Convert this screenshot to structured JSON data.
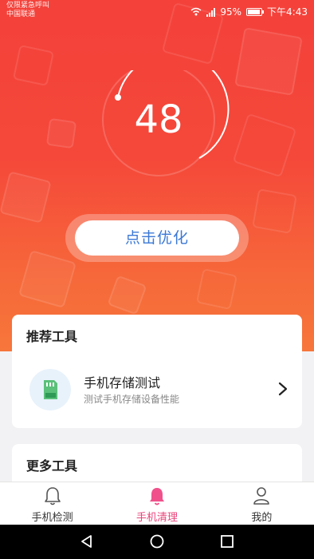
{
  "status_bar": {
    "carrier_line1": "仅限紧急呼叫",
    "carrier_line2": "中国联通",
    "battery": "95%",
    "time": "下午4:43",
    "icons": [
      "wifi-icon",
      "signal-icon",
      "battery-icon"
    ]
  },
  "score": {
    "value": "48"
  },
  "optimize_button": {
    "label": "点击优化"
  },
  "recommended": {
    "title": "推荐工具",
    "items": [
      {
        "name": "手机存储测试",
        "description": "测试手机存储设备性能",
        "icon": "sd-card-icon"
      }
    ]
  },
  "more": {
    "title": "更多工具"
  },
  "tabs": [
    {
      "label": "手机检测",
      "icon": "bell-outline-icon",
      "active": false
    },
    {
      "label": "手机清理",
      "icon": "bell-filled-icon",
      "active": true
    },
    {
      "label": "我的",
      "icon": "person-icon",
      "active": false
    }
  ],
  "colors": {
    "hero_top": "#f4413a",
    "hero_bottom": "#f7763b",
    "accent_blue": "#3b78d6",
    "active_tab": "#e8437a"
  }
}
